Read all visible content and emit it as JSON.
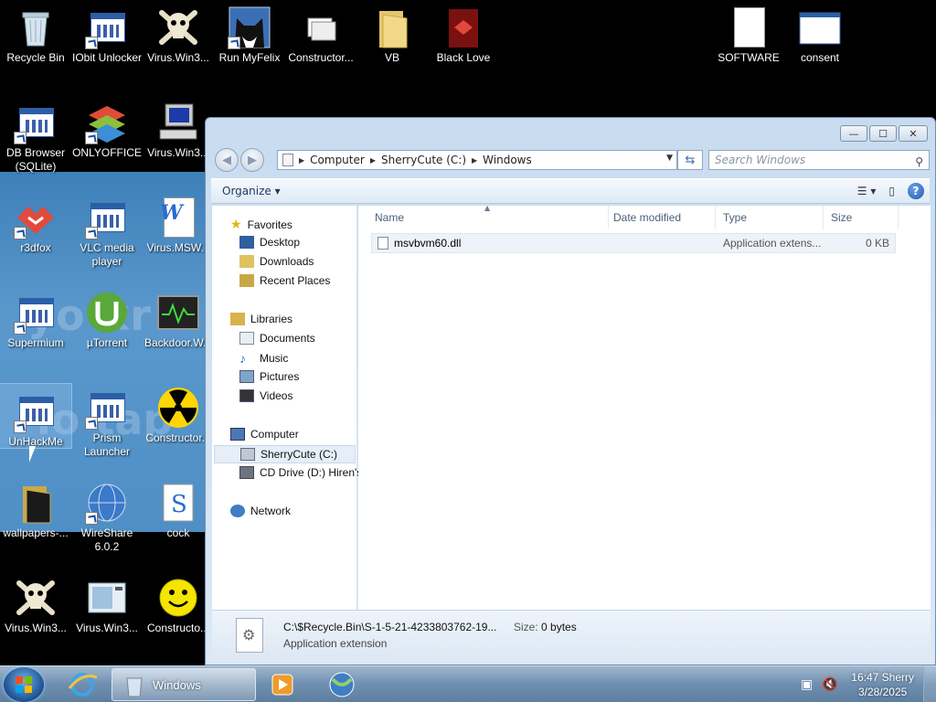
{
  "desktop": {
    "icons": [
      {
        "label": "Recycle Bin"
      },
      {
        "label": "IObit Unlocker"
      },
      {
        "label": "Virus.Win3..."
      },
      {
        "label": "Run MyFelix"
      },
      {
        "label": "Constructor..."
      },
      {
        "label": "VB"
      },
      {
        "label": "Black Love"
      },
      {
        "label": "SOFTWARE"
      },
      {
        "label": "consent"
      },
      {
        "label": "DB Browser (SQLite)"
      },
      {
        "label": "ONLYOFFICE"
      },
      {
        "label": "Virus.Win3..."
      },
      {
        "label": "r3dfox"
      },
      {
        "label": "VLC media player"
      },
      {
        "label": "Virus.MSW..."
      },
      {
        "label": "Supermium"
      },
      {
        "label": "µTorrent"
      },
      {
        "label": "Backdoor.W..."
      },
      {
        "label": "UnHackMe"
      },
      {
        "label": "Prism Launcher"
      },
      {
        "label": "Constructor..."
      },
      {
        "label": "wallpapers-..."
      },
      {
        "label": "WireShare 6.0.2"
      },
      {
        "label": "cock"
      },
      {
        "label": "Virus.Win3..."
      },
      {
        "label": "Virus.Win3..."
      },
      {
        "label": "Constructo..."
      }
    ],
    "wallpaper_text": [
      "yo  kr",
      "lo  tap"
    ]
  },
  "explorer": {
    "title": "Windows",
    "caption": {
      "minimize": "—",
      "maximize": "☐",
      "close": "✕"
    },
    "nav": {
      "back": "◀",
      "forward": "▶"
    },
    "breadcrumb": [
      "Computer",
      "SherryCute (C:)",
      "Windows"
    ],
    "search_placeholder": "Search Windows",
    "toolbar": {
      "organize": "Organize ▾"
    },
    "nav_pane": {
      "favorites": "Favorites",
      "favorites_items": [
        "Desktop",
        "Downloads",
        "Recent Places"
      ],
      "libraries": "Libraries",
      "libraries_items": [
        "Documents",
        "Music",
        "Pictures",
        "Videos"
      ],
      "computer": "Computer",
      "computer_items": [
        "SherryCute (C:)",
        "CD Drive (D:) Hiren's"
      ],
      "network": "Network"
    },
    "columns": [
      "Name",
      "Date modified",
      "Type",
      "Size"
    ],
    "files": [
      {
        "name": "msvbvm60.dll",
        "date": "",
        "type": "Application extens...",
        "size": "0 KB"
      }
    ],
    "details": {
      "path": "C:\\$Recycle.Bin\\S-1-5-21-4233803762-19...",
      "size_label": "Size:",
      "size_value": "0 bytes",
      "type": "Application extension"
    }
  },
  "taskbar": {
    "active_window": "Windows",
    "clock_time": "16:47 Sherry",
    "clock_date": "3/28/2025"
  }
}
